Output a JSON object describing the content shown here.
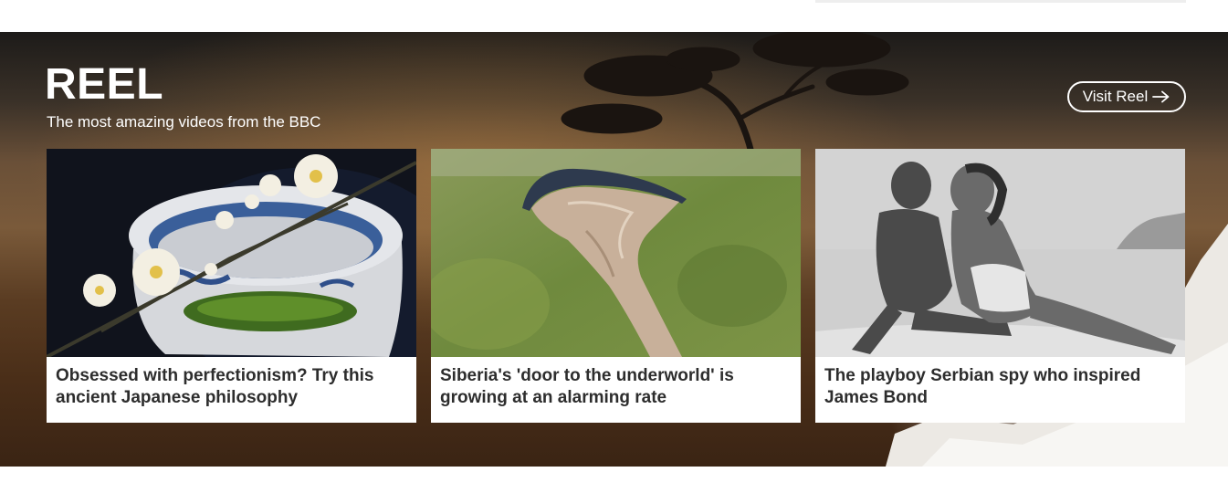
{
  "section": {
    "title": "REEL",
    "subtitle": "The most amazing videos from the BBC",
    "visit_label": "Visit Reel",
    "visit_icon": "arrow-right-icon"
  },
  "cards": [
    {
      "title": "Obsessed with perfectionism? Try this ancient Japanese philosophy"
    },
    {
      "title": "Siberia's 'door to the underworld' is growing at an alarming rate"
    },
    {
      "title": "The playboy Serbian spy who inspired James Bond"
    }
  ],
  "colors": {
    "caption_text": "#2d2d2d",
    "card_background": "#ffffff",
    "header_text": "#ffffff"
  }
}
